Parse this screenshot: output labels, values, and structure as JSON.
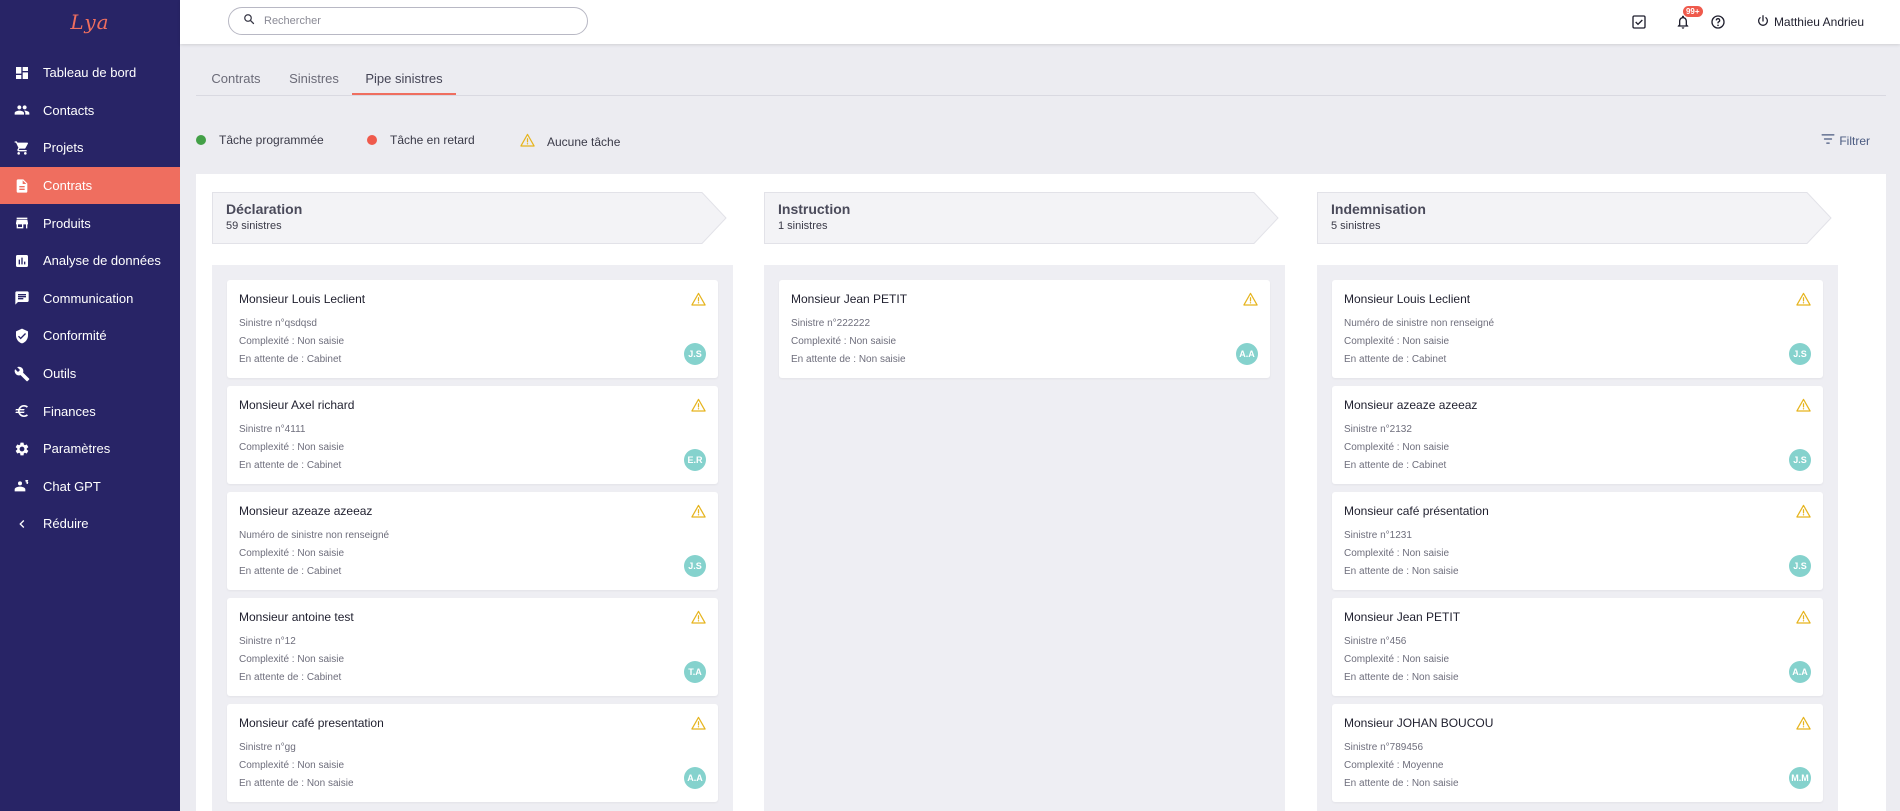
{
  "app": {
    "logo": "Lya"
  },
  "colors": {
    "sidebar": "#282466",
    "accent": "#ef6e5f",
    "avatar": "#85d2cd",
    "warning": "#e6b41e"
  },
  "sidebar": {
    "items": [
      {
        "label": "Tableau de bord",
        "icon": "dashboard-icon",
        "active": false
      },
      {
        "label": "Contacts",
        "icon": "people-icon",
        "active": false
      },
      {
        "label": "Projets",
        "icon": "cart-icon",
        "active": false
      },
      {
        "label": "Contrats",
        "icon": "document-icon",
        "active": true
      },
      {
        "label": "Produits",
        "icon": "store-icon",
        "active": false
      },
      {
        "label": "Analyse de données",
        "icon": "analytics-icon",
        "active": false
      },
      {
        "label": "Communication",
        "icon": "chat-icon",
        "active": false
      },
      {
        "label": "Conformité",
        "icon": "shield-check-icon",
        "active": false
      },
      {
        "label": "Outils",
        "icon": "tools-icon",
        "active": false
      },
      {
        "label": "Finances",
        "icon": "euro-icon",
        "active": false
      },
      {
        "label": "Paramètres",
        "icon": "gear-icon",
        "active": false
      },
      {
        "label": "Chat GPT",
        "icon": "chat-gpt-icon",
        "active": false
      },
      {
        "label": "Réduire",
        "icon": "chevron-left-icon",
        "active": false
      }
    ]
  },
  "header": {
    "search_placeholder": "Rechercher",
    "notification_badge": "99+",
    "user_name": "Matthieu Andrieu"
  },
  "tabs": [
    {
      "label": "Contrats",
      "active": false
    },
    {
      "label": "Sinistres",
      "active": false
    },
    {
      "label": "Pipe sinistres",
      "active": true
    }
  ],
  "legend": {
    "scheduled": "Tâche programmée",
    "late": "Tâche en retard",
    "none": "Aucune tâche",
    "filter": "Filtrer"
  },
  "columns": [
    {
      "title": "Déclaration",
      "count": "59 sinistres",
      "cards": [
        {
          "name": "Monsieur Louis Leclient",
          "number": "Sinistre n°qsdqsd",
          "complexity": "Complexité : Non saisie",
          "waiting": "En attente de : Cabinet",
          "initials": "J.S"
        },
        {
          "name": "Monsieur Axel richard",
          "number": "Sinistre n°4111",
          "complexity": "Complexité : Non saisie",
          "waiting": "En attente de : Cabinet",
          "initials": "E.R"
        },
        {
          "name": "Monsieur azeaze azeeaz",
          "number": "Numéro de sinistre non renseigné",
          "complexity": "Complexité : Non saisie",
          "waiting": "En attente de : Cabinet",
          "initials": "J.S"
        },
        {
          "name": "Monsieur antoine test",
          "number": "Sinistre n°12",
          "complexity": "Complexité : Non saisie",
          "waiting": "En attente de : Cabinet",
          "initials": "T.A"
        },
        {
          "name": "Monsieur café presentation",
          "number": "Sinistre n°gg",
          "complexity": "Complexité : Non saisie",
          "waiting": "En attente de : Non saisie",
          "initials": "A.A"
        }
      ]
    },
    {
      "title": "Instruction",
      "count": "1 sinistres",
      "cards": [
        {
          "name": "Monsieur Jean PETIT",
          "number": "Sinistre n°222222",
          "complexity": "Complexité : Non saisie",
          "waiting": "En attente de : Non saisie",
          "initials": "A.A"
        }
      ]
    },
    {
      "title": "Indemnisation",
      "count": "5 sinistres",
      "cards": [
        {
          "name": "Monsieur Louis Leclient",
          "number": "Numéro de sinistre non renseigné",
          "complexity": "Complexité : Non saisie",
          "waiting": "En attente de : Cabinet",
          "initials": "J.S"
        },
        {
          "name": "Monsieur azeaze azeeaz",
          "number": "Sinistre n°2132",
          "complexity": "Complexité : Non saisie",
          "waiting": "En attente de : Cabinet",
          "initials": "J.S"
        },
        {
          "name": "Monsieur café présentation",
          "number": "Sinistre n°1231",
          "complexity": "Complexité : Non saisie",
          "waiting": "En attente de : Non saisie",
          "initials": "J.S"
        },
        {
          "name": "Monsieur Jean PETIT",
          "number": "Sinistre n°456",
          "complexity": "Complexité : Non saisie",
          "waiting": "En attente de : Non saisie",
          "initials": "A.A"
        },
        {
          "name": "Monsieur JOHAN BOUCOU",
          "number": "Sinistre n°789456",
          "complexity": "Complexité : Moyenne",
          "waiting": "En attente de : Non saisie",
          "initials": "M.M"
        }
      ]
    }
  ]
}
